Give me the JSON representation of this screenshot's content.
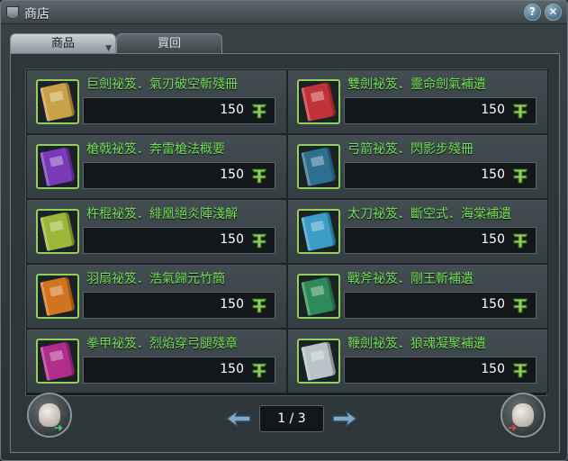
{
  "window": {
    "title": "商店",
    "help_label": "?",
    "close_label": "✕",
    "icons": {
      "help": "help-icon",
      "close": "close-icon",
      "title": "shield-icon"
    }
  },
  "tabs": [
    {
      "label": "商品",
      "active": true
    },
    {
      "label": "買回",
      "active": false
    }
  ],
  "items": [
    {
      "name": "巨劍祕笈．氣刃破空斬殘冊",
      "price": "150",
      "color": "#c7a24a"
    },
    {
      "name": "雙劍祕笈．靈命劍氣補遺",
      "price": "150",
      "color": "#c0333a"
    },
    {
      "name": "槍戟祕笈．奔雷槍法概要",
      "price": "150",
      "color": "#7a3ab8"
    },
    {
      "name": "弓箭祕笈．閃影步殘冊",
      "price": "150",
      "color": "#2d6f8f"
    },
    {
      "name": "杵棍祕笈．緋凰絕炎陣淺解",
      "price": "150",
      "color": "#9bb73a"
    },
    {
      "name": "太刀祕笈．斷空式．海棠補遺",
      "price": "150",
      "color": "#3b9cc4"
    },
    {
      "name": "羽扇祕笈．浩氣歸元竹簡",
      "price": "150",
      "color": "#d2741f"
    },
    {
      "name": "戰斧祕笈．剛王斬補遺",
      "price": "150",
      "color": "#2f8a5a"
    },
    {
      "name": "拳甲祕笈．烈焰穿弓腿殘章",
      "price": "150",
      "color": "#b02d8c"
    },
    {
      "name": "鞭劍祕笈．狼魂凝聚補遺",
      "price": "150",
      "color": "#b9c3c8"
    }
  ],
  "currency_icon": "jade-coin-icon",
  "pager": {
    "page_text": "1 / 3",
    "prev_icon": "chevron-left-icon",
    "next_icon": "chevron-right-icon"
  },
  "buttons": {
    "left_icon": "bag-in-icon",
    "right_icon": "bag-out-icon"
  },
  "colors": {
    "item_name": "#74e15a",
    "selected_border": "#8fd15a"
  }
}
